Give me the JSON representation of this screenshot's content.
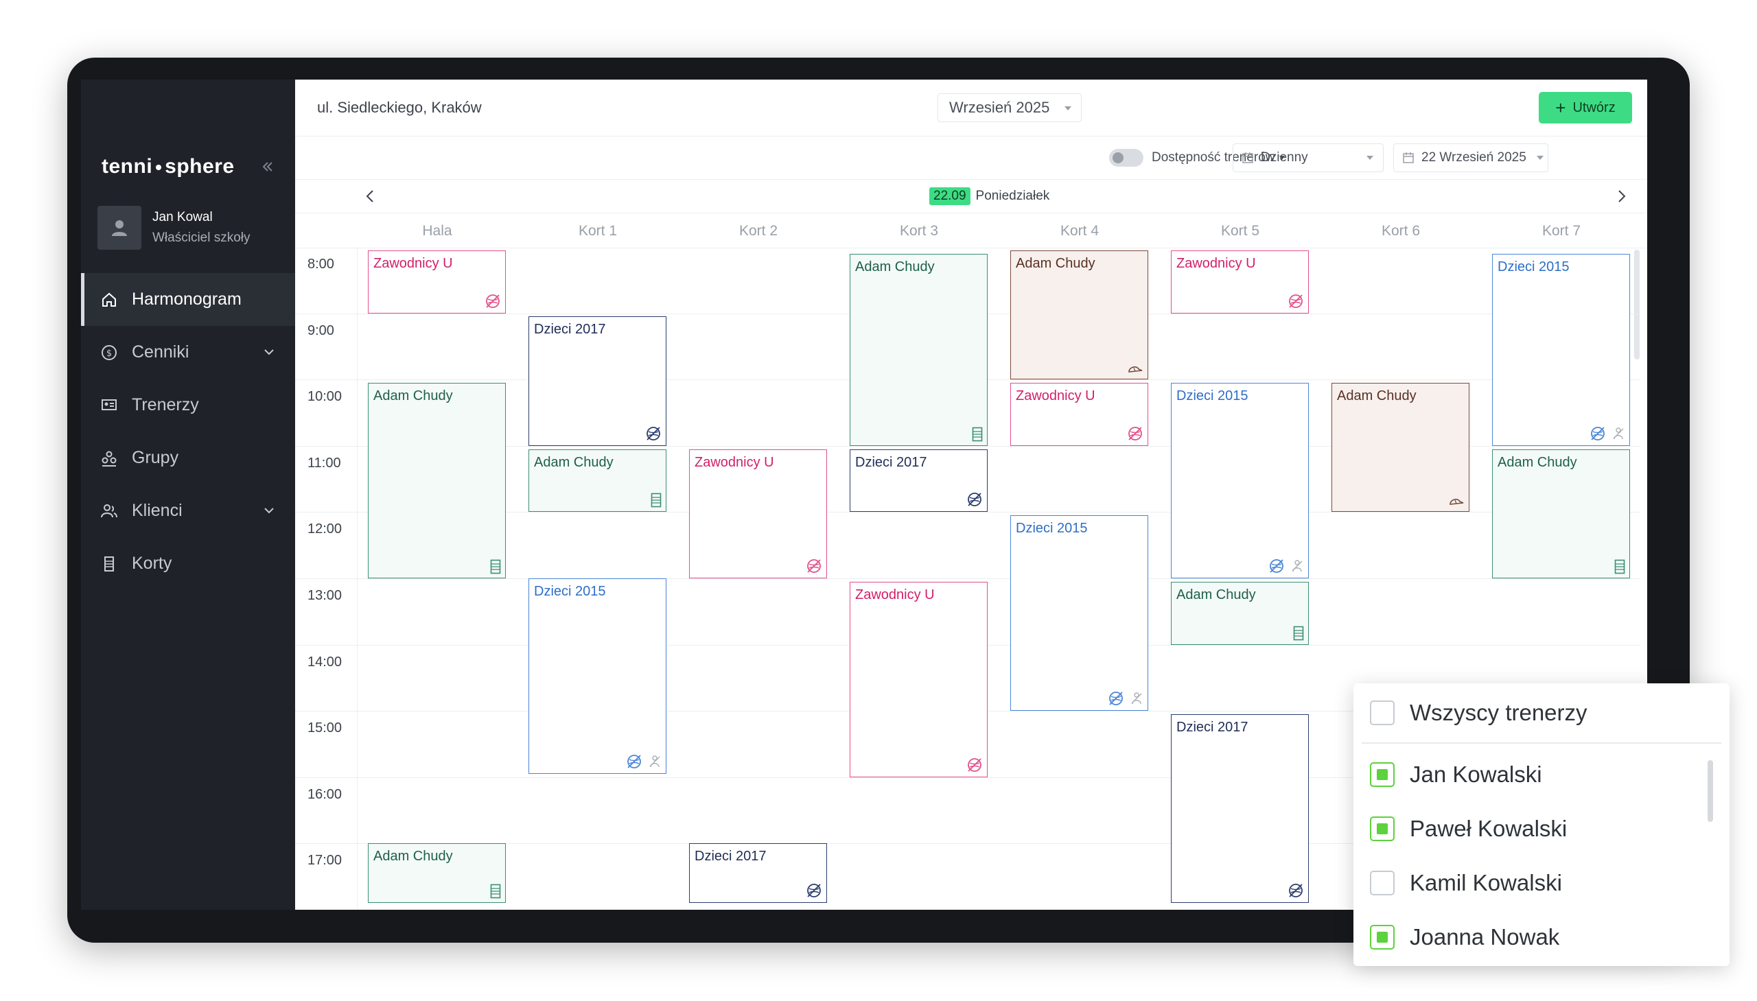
{
  "sidebar": {
    "brand_left": "tenni",
    "brand_right": "sphere",
    "collapse_icon": "double-chevron-left-icon",
    "user": {
      "name": "Jan Kowal",
      "role": "Właściciel szkoły"
    },
    "items": [
      {
        "label": "Harmonogram",
        "icon": "home-icon",
        "active": true
      },
      {
        "label": "Cenniki",
        "icon": "dollar-circle-icon",
        "expandable": true
      },
      {
        "label": "Trenerzy",
        "icon": "trainer-board-icon"
      },
      {
        "label": "Grupy",
        "icon": "group-icon"
      },
      {
        "label": "Klienci",
        "icon": "clients-icon",
        "expandable": true
      },
      {
        "label": "Korty",
        "icon": "court-icon"
      }
    ]
  },
  "header": {
    "location": "ul. Siedleckiego, Kraków",
    "month": "Wrzesień 2025",
    "create_label": "Utwórz"
  },
  "filters": {
    "availability_label": "Dostępność trenerów",
    "view_label": "Dzienny",
    "date_label": "22 Wrzesień 2025"
  },
  "day": {
    "badge": "22.09",
    "name": "Poniedziałek"
  },
  "columns": [
    "Hala",
    "Kort 1",
    "Kort 2",
    "Kort 3",
    "Kort 4",
    "Kort 5",
    "Kort 6",
    "Kort 7"
  ],
  "times": [
    "8:00",
    "9:00",
    "10:00",
    "11:00",
    "12:00",
    "13:00",
    "14:00",
    "15:00",
    "16:00",
    "17:00"
  ],
  "events": [
    {
      "title": "Zawodnicy U",
      "col": 0,
      "start": 8.05,
      "end": 9.0,
      "kind": "pink",
      "icons": [
        "no-ball-icon"
      ]
    },
    {
      "title": "Adam Chudy",
      "col": 0,
      "start": 10.05,
      "end": 13.0,
      "kind": "green",
      "icons": [
        "court-icon"
      ]
    },
    {
      "title": "Adam Chudy",
      "col": 0,
      "start": 17.0,
      "end": 17.9,
      "kind": "green",
      "icons": [
        "court-icon"
      ]
    },
    {
      "title": "Dzieci 2017",
      "col": 1,
      "start": 9.05,
      "end": 11.0,
      "kind": "navy",
      "icons": [
        "no-ball-icon"
      ]
    },
    {
      "title": "Adam Chudy",
      "col": 1,
      "start": 11.05,
      "end": 12.0,
      "kind": "green",
      "icons": [
        "court-icon"
      ]
    },
    {
      "title": "Dzieci 2015",
      "col": 1,
      "start": 13.0,
      "end": 15.95,
      "kind": "blue",
      "icons": [
        "no-ball-icon",
        "person-off-icon"
      ]
    },
    {
      "title": "Zawodnicy U",
      "col": 2,
      "start": 11.05,
      "end": 13.0,
      "kind": "pink",
      "icons": [
        "no-ball-icon"
      ]
    },
    {
      "title": "Dzieci 2017",
      "col": 2,
      "start": 17.0,
      "end": 17.9,
      "kind": "navy",
      "icons": [
        "no-ball-icon"
      ]
    },
    {
      "title": "Adam Chudy",
      "col": 3,
      "start": 8.1,
      "end": 11.0,
      "kind": "green",
      "icons": [
        "court-icon"
      ]
    },
    {
      "title": "Dzieci 2017",
      "col": 3,
      "start": 11.05,
      "end": 12.0,
      "kind": "navy",
      "icons": [
        "no-ball-icon"
      ]
    },
    {
      "title": "Zawodnicy U",
      "col": 3,
      "start": 13.05,
      "end": 16.0,
      "kind": "pink",
      "icons": [
        "no-ball-icon"
      ]
    },
    {
      "title": "Adam Chudy",
      "col": 4,
      "start": 8.05,
      "end": 10.0,
      "kind": "brown",
      "icons": [
        "cap-icon"
      ]
    },
    {
      "title": "Zawodnicy U",
      "col": 4,
      "start": 10.05,
      "end": 11.0,
      "kind": "pink",
      "icons": [
        "no-ball-icon"
      ]
    },
    {
      "title": "Dzieci 2015",
      "col": 4,
      "start": 12.05,
      "end": 15.0,
      "kind": "blue",
      "icons": [
        "no-ball-icon",
        "person-off-icon"
      ]
    },
    {
      "title": "Zawodnicy U",
      "col": 5,
      "start": 8.05,
      "end": 9.0,
      "kind": "pink",
      "icons": [
        "no-ball-icon"
      ]
    },
    {
      "title": "Dzieci 2015",
      "col": 5,
      "start": 10.05,
      "end": 13.0,
      "kind": "blue",
      "icons": [
        "no-ball-icon",
        "person-off-icon"
      ]
    },
    {
      "title": "Adam Chudy",
      "col": 5,
      "start": 13.05,
      "end": 14.0,
      "kind": "green",
      "icons": [
        "court-icon"
      ]
    },
    {
      "title": "Dzieci 2017",
      "col": 5,
      "start": 15.05,
      "end": 17.9,
      "kind": "navy",
      "icons": [
        "no-ball-icon"
      ]
    },
    {
      "title": "Adam Chudy",
      "col": 6,
      "start": 10.05,
      "end": 12.0,
      "kind": "brown",
      "icons": [
        "cap-icon"
      ]
    },
    {
      "title": "Dzieci 2015",
      "col": 7,
      "start": 8.1,
      "end": 11.0,
      "kind": "blue",
      "icons": [
        "no-ball-icon",
        "person-off-icon"
      ]
    },
    {
      "title": "Adam Chudy",
      "col": 7,
      "start": 11.05,
      "end": 13.0,
      "kind": "green",
      "icons": [
        "court-icon"
      ]
    }
  ],
  "trainer_filter": {
    "all_label": "Wszyscy trenerzy",
    "all_checked": false,
    "trainers": [
      {
        "name": "Jan Kowalski",
        "checked": true
      },
      {
        "name": "Paweł Kowalski",
        "checked": true
      },
      {
        "name": "Kamil Kowalski",
        "checked": false
      },
      {
        "name": "Joanna Nowak",
        "checked": true
      }
    ]
  },
  "colors": {
    "accent_green": "#3ddc84",
    "sidebar_bg": "#1f2329",
    "pink": "#e3508a",
    "green": "#3a8f73",
    "brown": "#7a4a3c",
    "blue": "#4a86d8",
    "navy": "#2b3d6e",
    "checkbox_green": "#5cd23c"
  }
}
